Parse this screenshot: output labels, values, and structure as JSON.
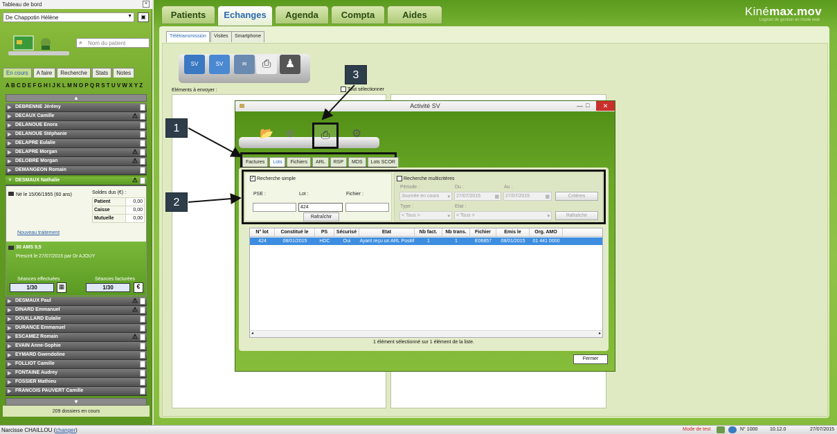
{
  "left_panel": {
    "window_title": "Tableau de bord",
    "patient_select": "De Chappotin Hélène",
    "search_placeholder": "Nom du patient",
    "tabs": [
      "En cours",
      "A faire",
      "Recherche",
      "Stats",
      "Notes"
    ],
    "alphabet": "ABCDEFGHIJKLMNOPQRSTUVWXYZ",
    "patients_top": [
      {
        "name": "DEBRENNE Jérémy",
        "warn": false
      },
      {
        "name": "DECAUX Camille",
        "warn": true
      },
      {
        "name": "DELANOUE Enora",
        "warn": false
      },
      {
        "name": "DELANOUE Stéphanie",
        "warn": false
      },
      {
        "name": "DELAPRE Eulalie",
        "warn": false
      },
      {
        "name": "DELAPRE Morgan",
        "warn": true
      },
      {
        "name": "DELOBRE Morgan",
        "warn": true
      },
      {
        "name": "DEMANGEON Romain",
        "warn": false
      }
    ],
    "selected_patient": "DESMAUX Nathalie",
    "detail": {
      "born": "Né le 15/06/1955 (60 ans)",
      "soldes_label": "Soldes dus (€) :",
      "soldes": [
        {
          "label": "Patient",
          "value": "0,00"
        },
        {
          "label": "Caisse",
          "value": "0,00"
        },
        {
          "label": "Mutuelle",
          "value": "0,00"
        }
      ],
      "nouveau_traitement": "Nouveau traitement",
      "treatment_title": "30 AMS 9,5",
      "prescribed": "Prescrit le 27/07/2015 par Dr AJOUY",
      "seances_effectuees_label": "Séances effectuées",
      "seances_effectuees": "1/30",
      "seances_facturees_label": "Séances facturées",
      "seances_facturees": "1/30"
    },
    "patients_bottom": [
      {
        "name": "DESMAUX Paul",
        "warn": true
      },
      {
        "name": "DINARD Emmanuel",
        "warn": true
      },
      {
        "name": "DOUILLARD Eulalie",
        "warn": false
      },
      {
        "name": "DURANCE Emmanuel",
        "warn": false
      },
      {
        "name": "ESCAMEZ Romain",
        "warn": true
      },
      {
        "name": "EVAIN Anne-Sophie",
        "warn": false
      },
      {
        "name": "EYMARD Gwendoline",
        "warn": false
      },
      {
        "name": "FOLLIOT Camille",
        "warn": false
      },
      {
        "name": "FONTAINE Audrey",
        "warn": false
      },
      {
        "name": "FOSSIER Mathieu",
        "warn": false
      },
      {
        "name": "FRANCOIS PAUVERT Camille",
        "warn": false
      }
    ],
    "dossiers_count": "209 dossiers en cours"
  },
  "main_tabs": [
    "Patients",
    "Echanges",
    "Agenda",
    "Compta",
    "Aides"
  ],
  "logo": {
    "part1": "Kiné",
    "part2": "max.mov",
    "slogan": "Logiciel de gestion en mode web"
  },
  "sub_tabs": [
    "Télétransmission",
    "Visites",
    "Smartphone"
  ],
  "elements_label": "Eléments à envoyer :",
  "tout_selectionner": "Tout sélectionner",
  "dialog": {
    "title": "Activité SV",
    "tabs": [
      "Factures",
      "Lots",
      "Fichiers",
      "ARL",
      "RSP",
      "MDS",
      "Lots SCOR"
    ],
    "simple_label": "Recherche simple",
    "multi_label": "Recherche multicritères",
    "pse_label": "PSE :",
    "lot_label": "Lot :",
    "fichier_label": "Fichier :",
    "lot_value": "424",
    "rafraichir": "Rafraîchir",
    "periode_label": "Période :",
    "periode_value": "Journée en cours",
    "du_label": "Du :",
    "du_value": "27/07/2015",
    "au_label": "Au :",
    "au_value": "27/07/2015",
    "criteres": "Critères",
    "type_label": "Type :",
    "type_value": "< Tous >",
    "etat_label": "Etat :",
    "etat_value": "< Tous >",
    "columns": [
      "N° lot",
      "Constitué le",
      "PS",
      "Sécurisé",
      "Etat",
      "Nb fact.",
      "Nb trans.",
      "Fichier",
      "Emis le",
      "Org. AMO"
    ],
    "rows": [
      [
        "424",
        "08/01/2015",
        "HDC",
        "Oui",
        "Ayant reçu un ARL Positif",
        "1",
        "1",
        "E06857",
        "08/01/2015",
        "01 441 0000"
      ]
    ],
    "status": "1 élément sélectionné sur 1 élément de la liste.",
    "fermer": "Fermer"
  },
  "callouts": [
    "1",
    "2",
    "3"
  ],
  "status_bar": {
    "user": "Narcisse CHAILLOU",
    "changer": "changer",
    "mode": "Mode de test",
    "numero": "N° 1000",
    "version": "10.12.0",
    "date": "27/07/2015"
  },
  "colors": {
    "accent_green": "#6aa828",
    "selected_row": "#3d8ee0",
    "close_red": "#c9302c",
    "callout": "#2e3d4a"
  }
}
